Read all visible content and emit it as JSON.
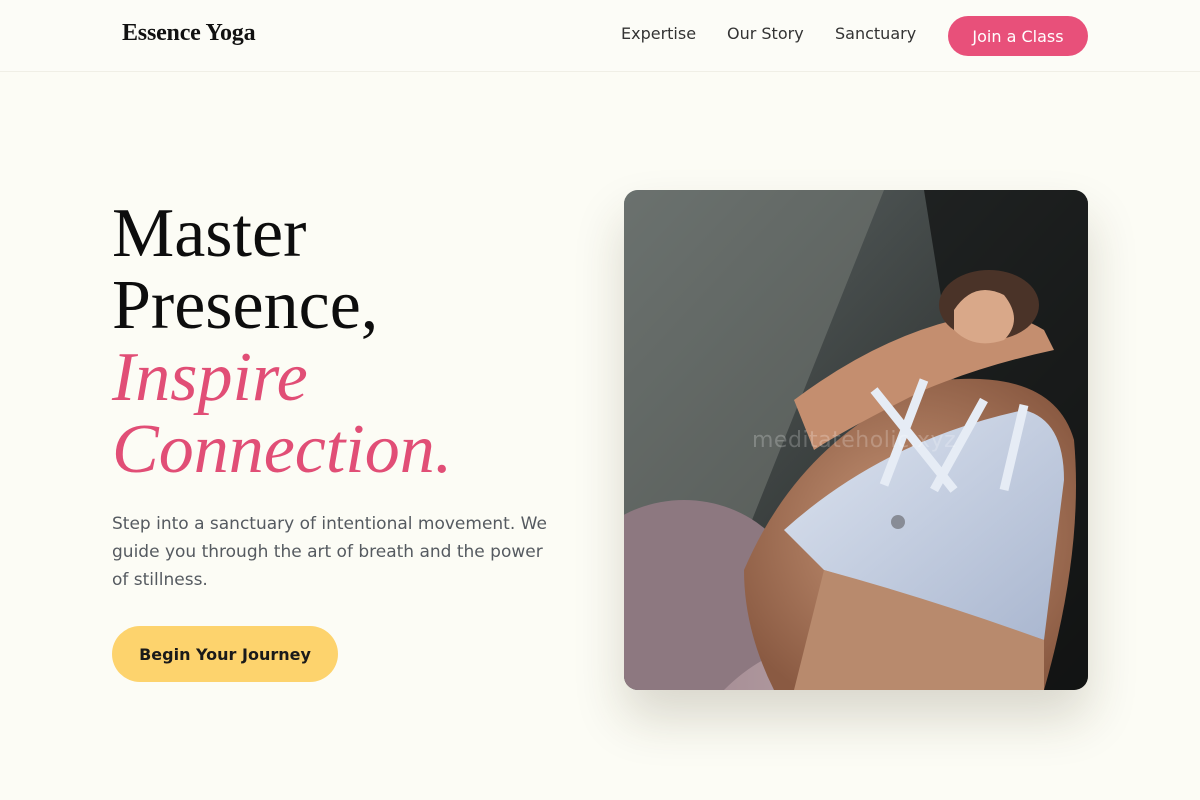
{
  "brand": {
    "name": "Essence Yoga"
  },
  "nav": {
    "links": [
      {
        "label": "Expertise"
      },
      {
        "label": "Our Story"
      },
      {
        "label": "Sanctuary"
      }
    ],
    "cta_label": "Join a Class"
  },
  "hero": {
    "title_lines": [
      "Master",
      "Presence,"
    ],
    "accent_lines": [
      "Inspire",
      "Connection."
    ],
    "subtitle": "Step into a sanctuary of intentional movement. We guide you through the art of breath and the power of stillness.",
    "cta_label": "Begin Your Journey",
    "image_watermark": "meditateholic.xyz"
  },
  "colors": {
    "background": "#fcfcf5",
    "accent_pink": "#e14e76",
    "button_pink": "#e8507a",
    "button_yellow": "#fdd36d"
  }
}
